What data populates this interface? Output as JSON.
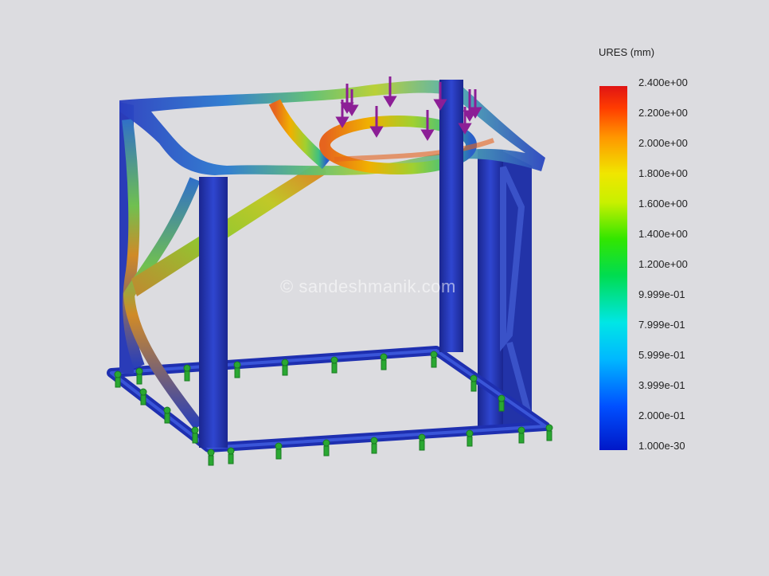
{
  "legend": {
    "title": "URES (mm)",
    "ticks": [
      "2.400e+00",
      "2.200e+00",
      "2.000e+00",
      "1.800e+00",
      "1.600e+00",
      "1.400e+00",
      "1.200e+00",
      "9.999e-01",
      "7.999e-01",
      "5.999e-01",
      "3.999e-01",
      "2.000e-01",
      "1.000e-30"
    ]
  },
  "watermark": "© sandeshmanik.com",
  "colors": {
    "background": "#dcdce0",
    "frame_low": "#1f2fa8",
    "frame_mid": "#78c832",
    "frame_high": "#e85a14",
    "load_arrow": "#8c1e96",
    "fixture": "#2aa832"
  },
  "icons": [
    "load-arrow-icon",
    "fixture-icon"
  ]
}
